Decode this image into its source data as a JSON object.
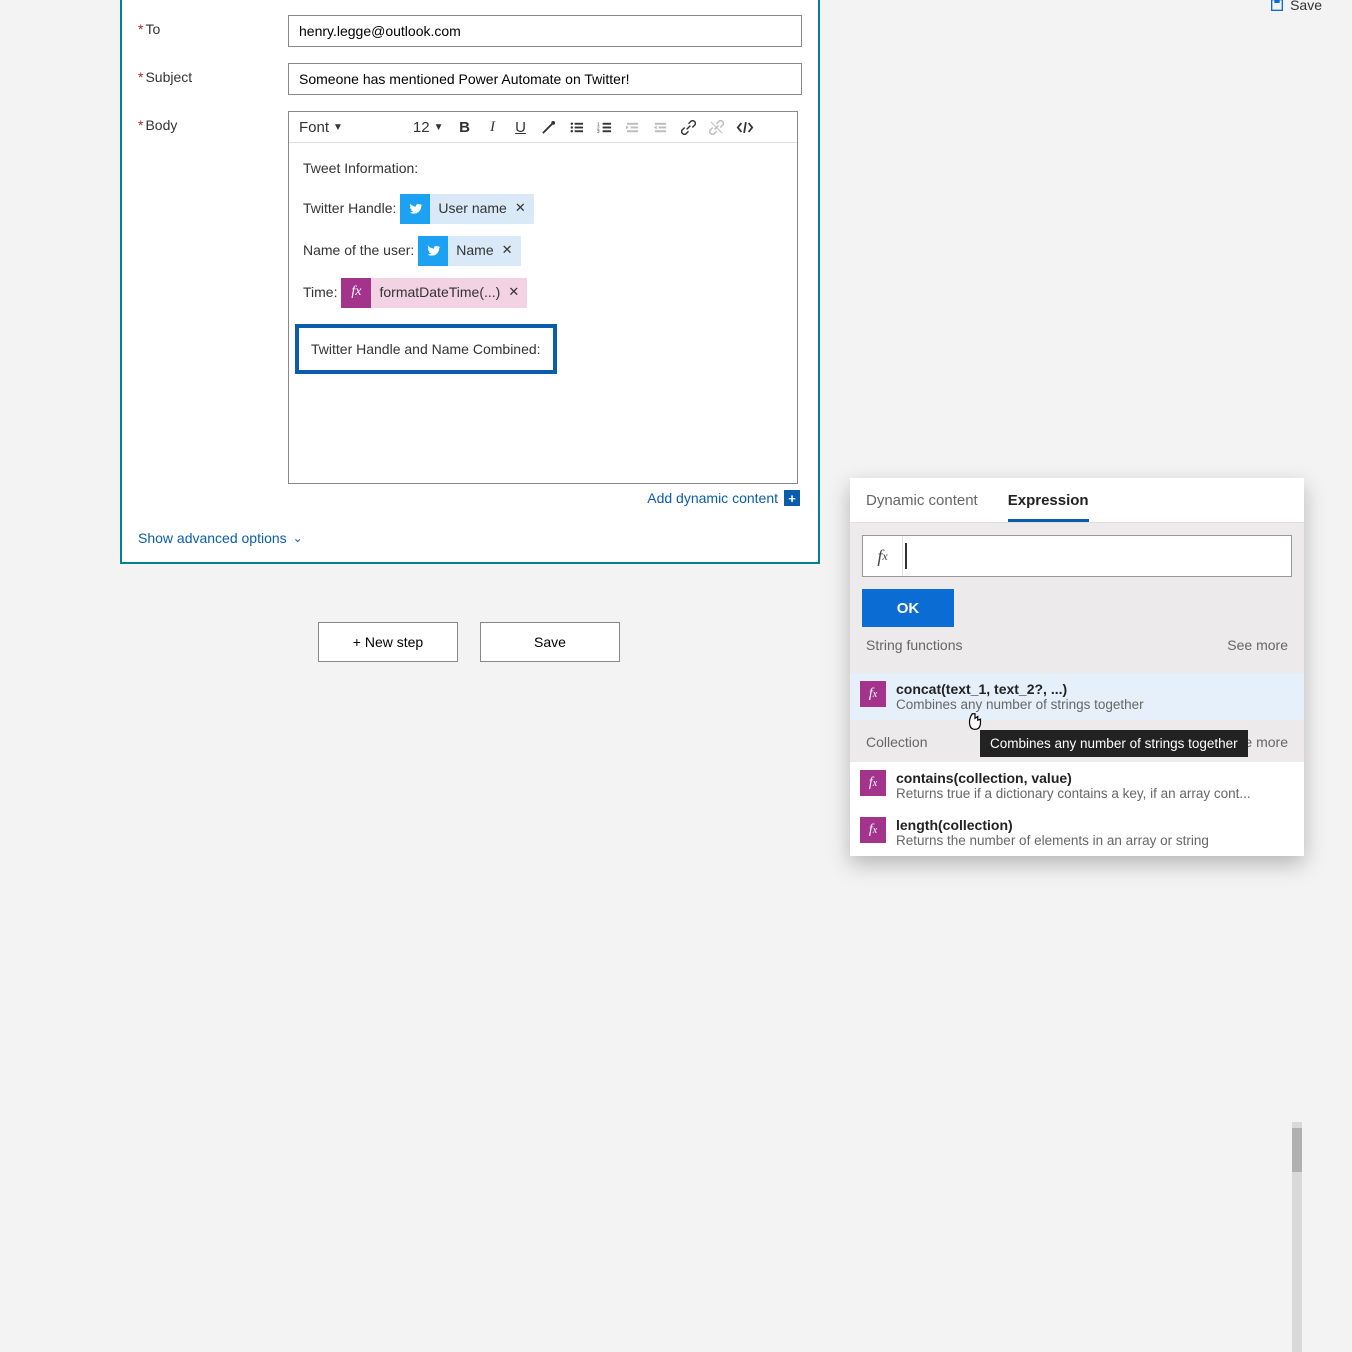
{
  "topbar": {
    "save": "Save"
  },
  "form": {
    "to_label": "To",
    "subject_label": "Subject",
    "body_label": "Body",
    "to_value": "henry.legge@outlook.com",
    "subject_value": "Someone has mentioned Power Automate on Twitter!"
  },
  "rte": {
    "font_label": "Font",
    "font_size": "12",
    "body_intro": "Tweet Information:",
    "line_twitter_handle": "Twitter Handle:",
    "token_username": "User name",
    "line_name_of_user": "Name of the user:",
    "token_name": "Name",
    "line_time": "Time:",
    "token_format": "formatDateTime(...)",
    "line_combined": "Twitter Handle and Name Combined:",
    "add_dynamic": "Add dynamic content"
  },
  "advanced_link": "Show advanced options",
  "buttons": {
    "new_step": "+ New step",
    "save": "Save"
  },
  "panel": {
    "tab_dynamic": "Dynamic content",
    "tab_expression": "Expression",
    "expr_value": "",
    "ok": "OK",
    "cat_string": "String functions",
    "see_more": "See more",
    "items_string": [
      {
        "sig": "concat(text_1, text_2?, ...)",
        "desc": "Combines any number of strings together"
      }
    ],
    "cat_collection": "Collection",
    "items_collection": [
      {
        "sig": "contains(collection, value)",
        "desc": "Returns true if a dictionary contains a key, if an array cont..."
      },
      {
        "sig": "length(collection)",
        "desc": "Returns the number of elements in an array or string"
      }
    ],
    "tooltip": "Combines any number of strings together"
  }
}
